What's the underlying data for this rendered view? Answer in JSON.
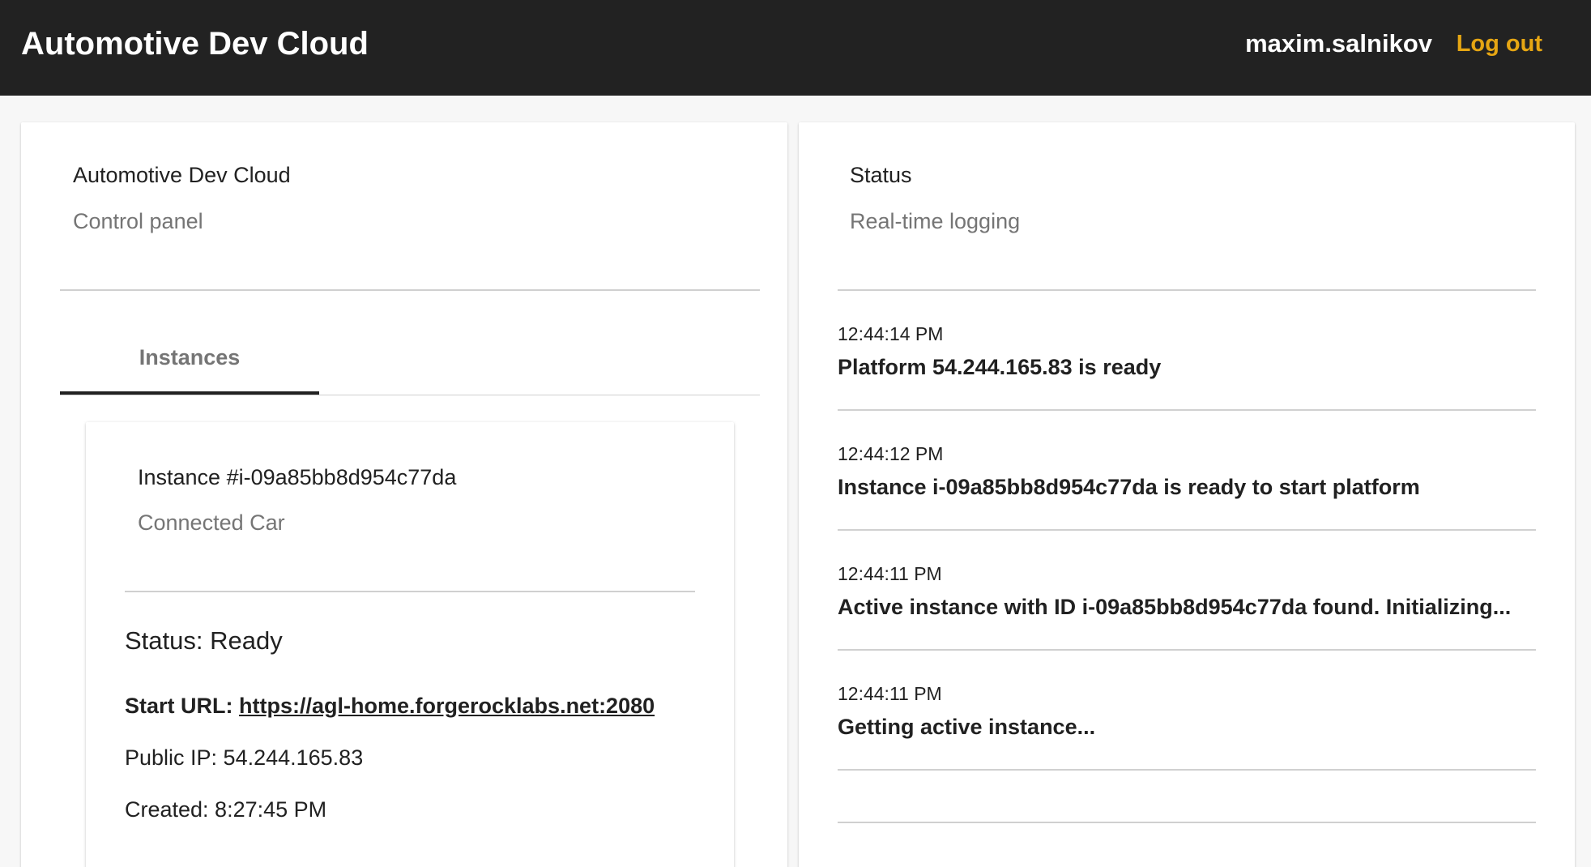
{
  "header": {
    "app_title": "Automotive Dev Cloud",
    "username": "maxim.salnikov",
    "logout_label": "Log out",
    "accent_color": "#e6a613",
    "background_color": "#222222"
  },
  "control_panel": {
    "title": "Automotive Dev Cloud",
    "subtitle": "Control panel",
    "tabs": [
      {
        "label": "Instances",
        "active": true
      }
    ],
    "instance": {
      "title": "Instance #i-09a85bb8d954c77da",
      "subtitle": "Connected Car",
      "status": "Status: Ready",
      "start_url_label": "Start URL:",
      "start_url": "https://agl-home.forgerocklabs.net:2080",
      "public_ip": "Public IP: 54.244.165.83",
      "created": "Created: 8:27:45 PM"
    }
  },
  "status_panel": {
    "title": "Status",
    "subtitle": "Real-time logging",
    "log": [
      {
        "time": "12:44:14 PM",
        "message": "Platform 54.244.165.83 is ready"
      },
      {
        "time": "12:44:12 PM",
        "message": "Instance i-09a85bb8d954c77da is ready to start platform"
      },
      {
        "time": "12:44:11 PM",
        "message": "Active instance with ID i-09a85bb8d954c77da found. Initializing..."
      },
      {
        "time": "12:44:11 PM",
        "message": "Getting active instance..."
      }
    ]
  }
}
